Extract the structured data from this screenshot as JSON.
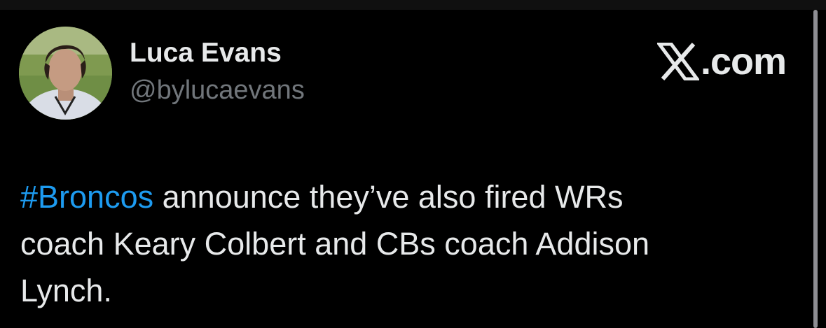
{
  "author": {
    "display_name": "Luca Evans",
    "handle": "@bylucaevans",
    "avatar_icon": "profile-photo"
  },
  "brand": {
    "label": ".com",
    "icon": "x-logo-icon"
  },
  "tweet": {
    "hashtag": "#Broncos",
    "line1_rest": " announce they’ve also fired WRs",
    "line2": "coach Keary Colbert and CBs coach Addison",
    "line3": "Lynch."
  },
  "colors": {
    "background": "#000000",
    "text": "#e7e9ea",
    "secondary_text": "#71767b",
    "hashtag": "#1d9bf0"
  }
}
